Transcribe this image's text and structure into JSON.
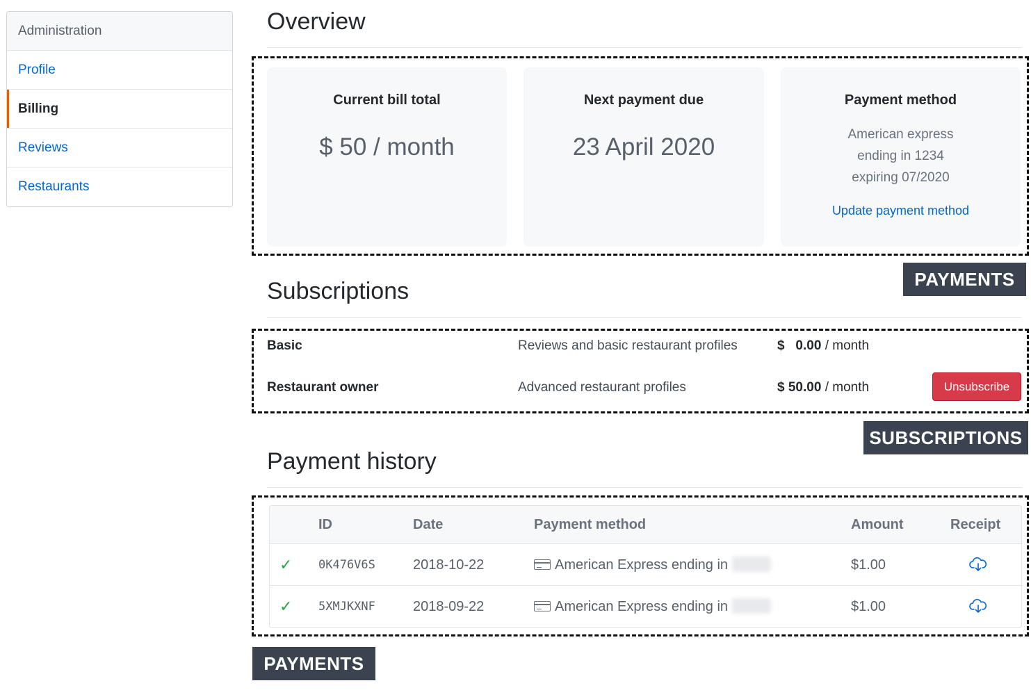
{
  "sidebar": {
    "header": "Administration",
    "items": [
      {
        "label": "Profile",
        "active": false
      },
      {
        "label": "Billing",
        "active": true
      },
      {
        "label": "Reviews",
        "active": false
      },
      {
        "label": "Restaurants",
        "active": false
      }
    ]
  },
  "overview": {
    "heading": "Overview",
    "cards": [
      {
        "title": "Current bill total",
        "value": "$ 50 / month"
      },
      {
        "title": "Next payment due",
        "value": "23 April 2020"
      },
      {
        "title": "Payment method",
        "lines": [
          "American express",
          "ending in 1234",
          "expiring 07/2020"
        ],
        "link": "Update payment method"
      }
    ],
    "tag": "PAYMENTS"
  },
  "subscriptions": {
    "heading": "Subscriptions",
    "rows": [
      {
        "name": "Basic",
        "description": "Reviews and basic restaurant profiles",
        "currency": "$",
        "amount": "0.00",
        "period": "/ month"
      },
      {
        "name": "Restaurant owner",
        "description": "Advanced restaurant profiles",
        "currency": "$",
        "amount": "50.00",
        "period": "/ month",
        "action": "Unsubscribe"
      }
    ],
    "tag": "SUBSCRIPTIONS"
  },
  "history": {
    "heading": "Payment history",
    "columns": [
      "ID",
      "Date",
      "Payment method",
      "Amount",
      "Receipt"
    ],
    "rows": [
      {
        "status": "✓",
        "id": "0K476V6S",
        "date": "2018-10-22",
        "method": "American Express ending in",
        "amount": "$1.00"
      },
      {
        "status": "✓",
        "id": "5XMJKXNF",
        "date": "2018-09-22",
        "method": "American Express ending in",
        "amount": "$1.00"
      }
    ],
    "tag": "PAYMENTS"
  },
  "colors": {
    "link": "#0366d6",
    "active_marker": "#e36209",
    "danger": "#d73a49",
    "success": "#28a745",
    "tag_bg": "#3b4350"
  }
}
